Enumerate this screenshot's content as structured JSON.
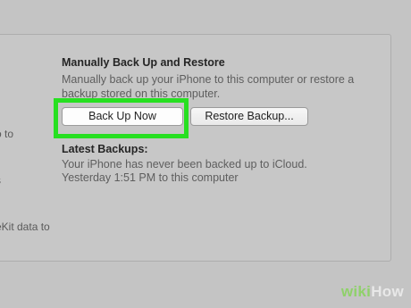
{
  "left_fragments": [
    "o to",
    "s",
    "eKit data to"
  ],
  "manual": {
    "title": "Manually Back Up and Restore",
    "description": "Manually back up your iPhone to this computer or restore a backup stored on this computer.",
    "back_up_button": "Back Up Now",
    "restore_button": "Restore Backup..."
  },
  "latest": {
    "title": "Latest Backups:",
    "lines": [
      "Your iPhone has never been backed up to iCloud.",
      "Yesterday 1:51 PM to this computer"
    ]
  },
  "watermark": {
    "prefix": "wiki",
    "suffix": "How"
  },
  "colors": {
    "highlight": "#27e021",
    "background": "#c4c4c4"
  }
}
